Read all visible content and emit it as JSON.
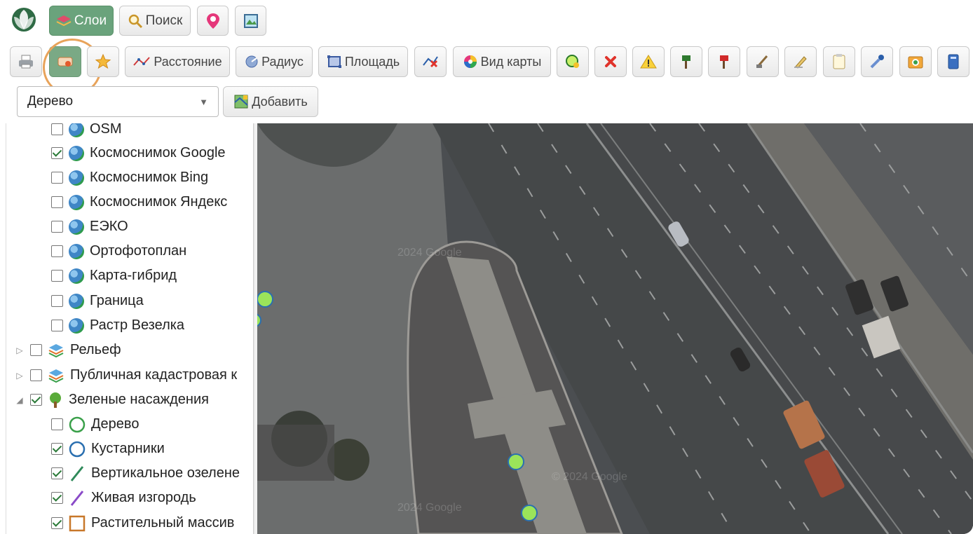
{
  "toolbar_top": {
    "layers_label": "Слои",
    "search_label": "Поиск"
  },
  "toolbar_tools": {
    "distance_label": "Расстояние",
    "radius_label": "Радиус",
    "area_label": "Площадь",
    "map_view_label": "Вид карты"
  },
  "layer_picker": {
    "selected": "Дерево",
    "add_label": "Добавить"
  },
  "tree": {
    "base_layers": [
      {
        "label": "OSM",
        "checked": false
      },
      {
        "label": "Космоснимок Google",
        "checked": true
      },
      {
        "label": "Космоснимок Bing",
        "checked": false
      },
      {
        "label": "Космоснимок Яндекс",
        "checked": false
      },
      {
        "label": "ЕЭКО",
        "checked": false
      },
      {
        "label": "Ортофотоплан",
        "checked": false
      },
      {
        "label": "Карта-гибрид",
        "checked": false
      },
      {
        "label": "Граница",
        "checked": false
      },
      {
        "label": "Растр Везелка",
        "checked": false
      }
    ],
    "groups": [
      {
        "label": "Рельеф",
        "checked": false,
        "expanded": false
      },
      {
        "label": "Публичная кадастровая к",
        "checked": false,
        "expanded": false
      },
      {
        "label": "Зеленые насаждения",
        "checked": true,
        "expanded": true
      }
    ],
    "green_children": [
      {
        "label": "Дерево",
        "checked": false,
        "icon": "circle-green-icon"
      },
      {
        "label": "Кустарники",
        "checked": true,
        "icon": "circle-blue-icon"
      },
      {
        "label": "Вертикальное озелене",
        "checked": true,
        "icon": "line-green-icon"
      },
      {
        "label": "Живая изгородь",
        "checked": true,
        "icon": "line-purple-icon"
      },
      {
        "label": "Растительный массив",
        "checked": true,
        "icon": "square-orange-icon"
      }
    ]
  },
  "map": {
    "watermark": "© 2024 Google",
    "watermark_short": "2024 Google"
  },
  "colors": {
    "accent": "#6aa37c",
    "highlight_ring": "#e8a35a",
    "point_fill": "#9be45a",
    "point_stroke": "#2a6fb0"
  }
}
